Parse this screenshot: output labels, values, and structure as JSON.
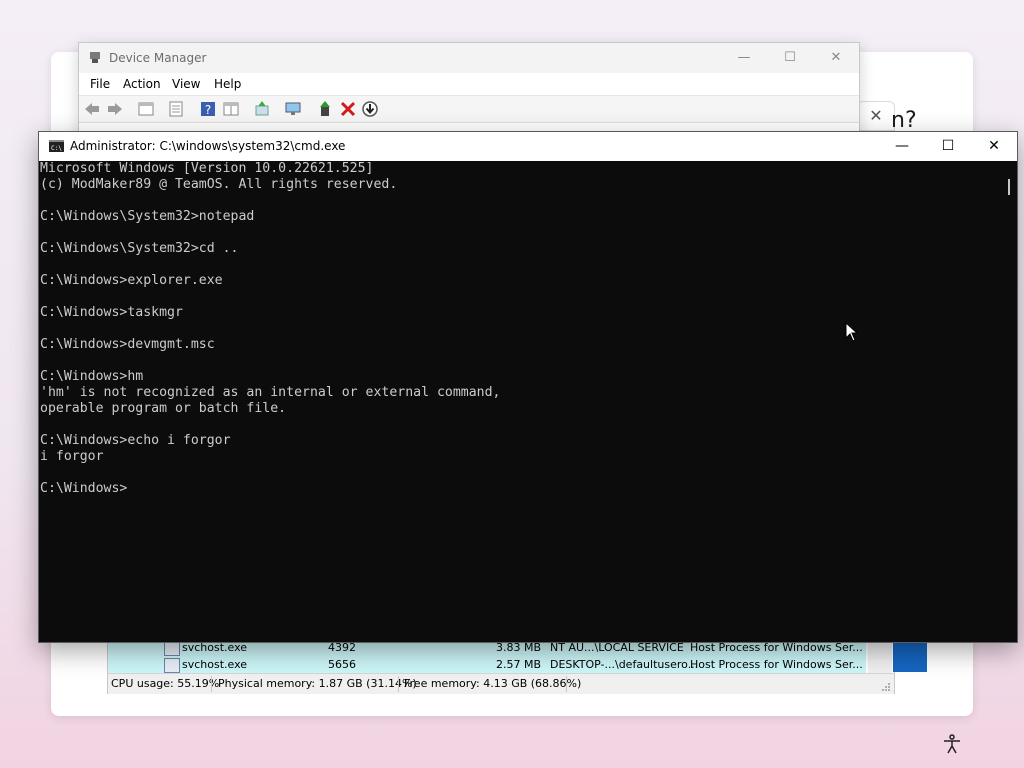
{
  "oobe": {
    "question_fragment": "n?",
    "close_glyph": "✕"
  },
  "device_manager": {
    "title": "Device Manager",
    "caption": {
      "minimize": "—",
      "maximize": "☐",
      "close": "✕"
    },
    "menu": [
      "File",
      "Action",
      "View",
      "Help"
    ]
  },
  "task_manager": {
    "rows": [
      {
        "name": "svchost.exe",
        "pid": "4392",
        "memory": "3.83 MB",
        "user": "NT AU...\\LOCAL SERVICE",
        "description": "Host Process for Windows Ser..."
      },
      {
        "name": "svchost.exe",
        "pid": "5656",
        "memory": "2.57 MB",
        "user": "DESKTOP-...\\defaultusero...",
        "description": "Host Process for Windows Ser..."
      }
    ],
    "status": {
      "cpu": "CPU usage: 55.19%",
      "physical": "Physical memory: 1.87 GB (31.14%)",
      "free": "Free memory: 4.13 GB (68.86%)"
    }
  },
  "cmd": {
    "title": "Administrator: C:\\windows\\system32\\cmd.exe",
    "caption": {
      "minimize": "—",
      "maximize": "☐",
      "close": "✕"
    },
    "lines": [
      "Microsoft Windows [Version 10.0.22621.525]",
      "(c) ModMaker89 @ TeamOS. All rights reserved.",
      "",
      "C:\\Windows\\System32>notepad",
      "",
      "C:\\Windows\\System32>cd ..",
      "",
      "C:\\Windows>explorer.exe",
      "",
      "C:\\Windows>taskmgr",
      "",
      "C:\\Windows>devmgmt.msc",
      "",
      "C:\\Windows>hm",
      "'hm' is not recognized as an internal or external command,",
      "operable program or batch file.",
      "",
      "C:\\Windows>echo i forgor",
      "i forgor",
      "",
      "C:\\Windows>"
    ]
  },
  "colors": {
    "console_bg": "#0c0c0c",
    "console_text": "#cccccc",
    "taskmgr_highlight": "#ccf6f8",
    "error_red": "#d11a1a"
  }
}
